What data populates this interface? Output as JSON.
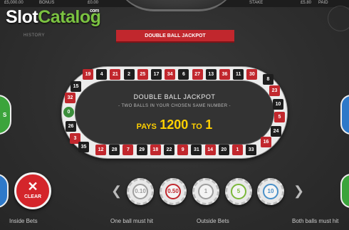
{
  "header": {
    "balance": "£5,000.00",
    "bonus_label": "BONUS",
    "win_value": "£0.00",
    "stake_label": "STAKE",
    "stake_value": "£5.80",
    "paid_label": "PAID"
  },
  "logo": {
    "part1": "Slot",
    "part2": "Catalog",
    "suffix": "com"
  },
  "history_label": "HISTORY",
  "jackpot_banner": "DOUBLE BALL JACKPOT",
  "racetrack": {
    "top_row": [
      "19",
      "4",
      "21",
      "2",
      "25",
      "17",
      "34",
      "6",
      "27",
      "13",
      "36",
      "11",
      "30"
    ],
    "bottom_row": [
      "12",
      "28",
      "7",
      "29",
      "18",
      "22",
      "9",
      "31",
      "14",
      "20",
      "1",
      "33"
    ],
    "left_side": [
      "15",
      "32",
      "0",
      "26",
      "3",
      "35"
    ],
    "right_side": [
      "8",
      "23",
      "10",
      "5",
      "24",
      "16"
    ]
  },
  "info": {
    "title": "DOUBLE BALL JACKPOT",
    "subtitle": "- TWO BALLS IN YOUR CHOSEN SAME NUMBER -",
    "pays_label": "PAYS",
    "pays_value": "1200",
    "to_label": "TO",
    "to_value": "1"
  },
  "side_buttons": {
    "left_green_label": "S"
  },
  "clear_button": {
    "label": "CLEAR",
    "icon": "close-icon"
  },
  "chips": [
    {
      "value": "0.10",
      "color": "#9e9e9e"
    },
    {
      "value": "0.50",
      "color": "#c1272d"
    },
    {
      "value": "1",
      "color": "#9e9e9e"
    },
    {
      "value": "5",
      "color": "#7bb83a"
    },
    {
      "value": "10",
      "color": "#4a90c8"
    }
  ],
  "arrows": {
    "left": "❮",
    "right": "❯"
  },
  "bottom_labels": {
    "inside_bets": "Inside Bets",
    "one_ball": "One ball must hit",
    "outside_bets": "Outside Bets",
    "both_balls": "Both balls must hit"
  },
  "colors": {
    "red": "#c1272d",
    "black": "#1e1e1e",
    "green": "#3b8e3b",
    "gold": "#ffd000",
    "blue": "#2e79c9"
  }
}
